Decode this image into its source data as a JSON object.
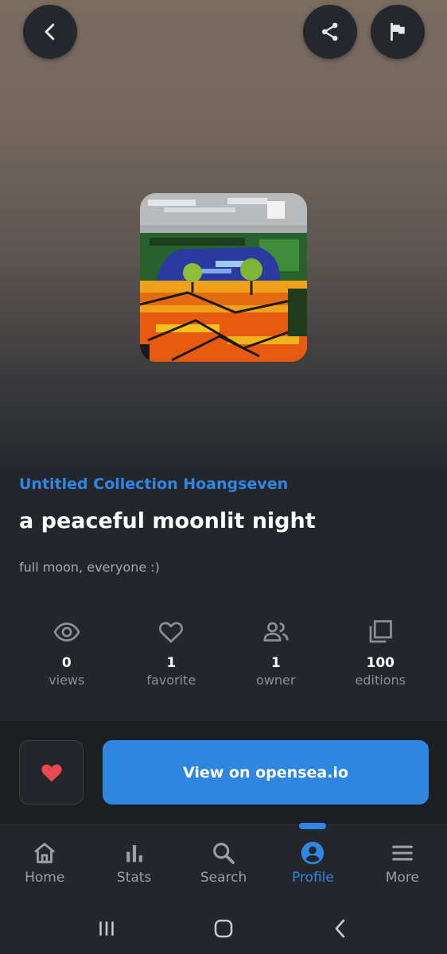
{
  "colors": {
    "accent": "#2f87e3",
    "background": "#23262b",
    "heart": "#e84a4f"
  },
  "header": {
    "back_icon": "chevron-left-icon",
    "share_icon": "share-icon",
    "report_icon": "flag-icon"
  },
  "nft": {
    "collection": "Untitled Collection Hoangseven",
    "title": "a peaceful moonlit night",
    "description": "full moon, everyone :)",
    "artwork_icon": "pixel-art-moonlit-landscape"
  },
  "stats": [
    {
      "icon": "eye-icon",
      "value": "0",
      "label": "views"
    },
    {
      "icon": "heart-outline-icon",
      "value": "1",
      "label": "favorite"
    },
    {
      "icon": "people-icon",
      "value": "1",
      "label": "owner"
    },
    {
      "icon": "copies-icon",
      "value": "100",
      "label": "editions"
    }
  ],
  "actions": {
    "favorite_icon": "heart-filled-icon",
    "view_label": "View on opensea.io"
  },
  "nav": [
    {
      "icon": "home-icon",
      "label": "Home",
      "active": false
    },
    {
      "icon": "bar-chart-icon",
      "label": "Stats",
      "active": false
    },
    {
      "icon": "search-icon",
      "label": "Search",
      "active": false
    },
    {
      "icon": "profile-icon",
      "label": "Profile",
      "active": true
    },
    {
      "icon": "menu-icon",
      "label": "More",
      "active": false
    }
  ],
  "system_nav": [
    "recent-apps-icon",
    "home-circle-icon",
    "back-icon"
  ]
}
